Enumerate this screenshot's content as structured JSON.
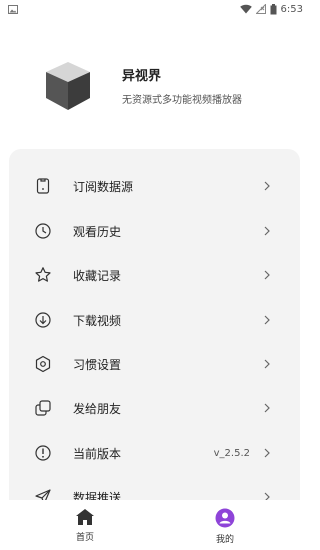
{
  "status": {
    "time": "6:53"
  },
  "profile": {
    "app_name": "异视界",
    "description": "无资源式多功能视频播放器"
  },
  "menu": [
    {
      "label": "订阅数据源",
      "icon": "subscription-icon"
    },
    {
      "label": "观看历史",
      "icon": "clock-icon"
    },
    {
      "label": "收藏记录",
      "icon": "star-icon"
    },
    {
      "label": "下载视频",
      "icon": "download-icon"
    },
    {
      "label": "习惯设置",
      "icon": "settings-icon"
    },
    {
      "label": "发给朋友",
      "icon": "share-icon"
    },
    {
      "label": "当前版本",
      "icon": "info-icon",
      "value": "v_2.5.2"
    },
    {
      "label": "数据推送",
      "icon": "send-icon"
    }
  ],
  "bottom_nav": [
    {
      "label": "首页",
      "icon": "home-icon"
    },
    {
      "label": "我的",
      "icon": "user-icon",
      "active_color": "#8e44d8"
    }
  ]
}
